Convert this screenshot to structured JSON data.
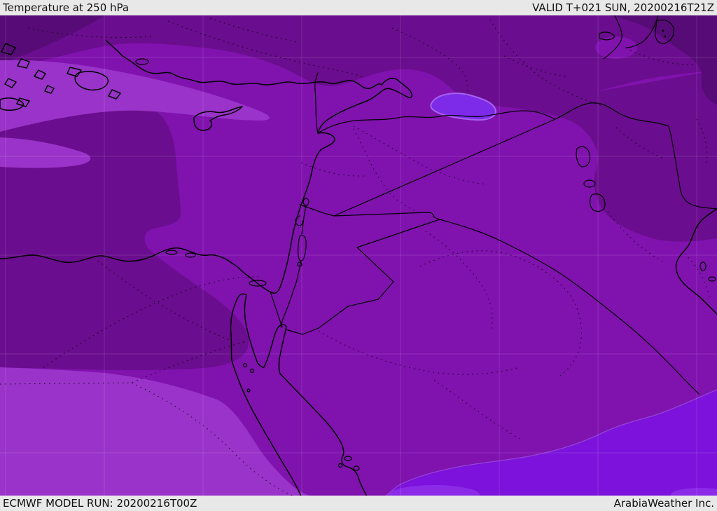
{
  "header": {
    "title": "Temperature at 250 hPa",
    "valid_label": "VALID T+021 SUN, 20200216T21Z"
  },
  "footer": {
    "model_run": "ECMWF MODEL RUN: 20200216T00Z",
    "credit": "ArabiaWeather Inc."
  },
  "map": {
    "field": "Temperature at 250 hPa",
    "region": "Middle East / Eastern Mediterranean (Turkey, Cyprus, Levant, Egypt, Red Sea, Iraq, Iran, Saudi Arabia)",
    "model": "ECMWF",
    "run": "20200216T00Z",
    "valid": "20200216T21Z",
    "lead_time": "T+021",
    "colors": {
      "bar_bg": "#e8e8e8",
      "bar_text": "#111111",
      "base": "#8012AE",
      "dark": "#6A0D8E",
      "darkest": "#570B76",
      "lighter": "#9933C9",
      "bright": "#7C12DB",
      "brightest": "#8B2BE8",
      "cold_pocket": "#7D2BE9",
      "cold_pocket_halo": "#A763F0",
      "coastline": "#000000",
      "gridline": "rgba(255,255,255,0.13)"
    }
  }
}
